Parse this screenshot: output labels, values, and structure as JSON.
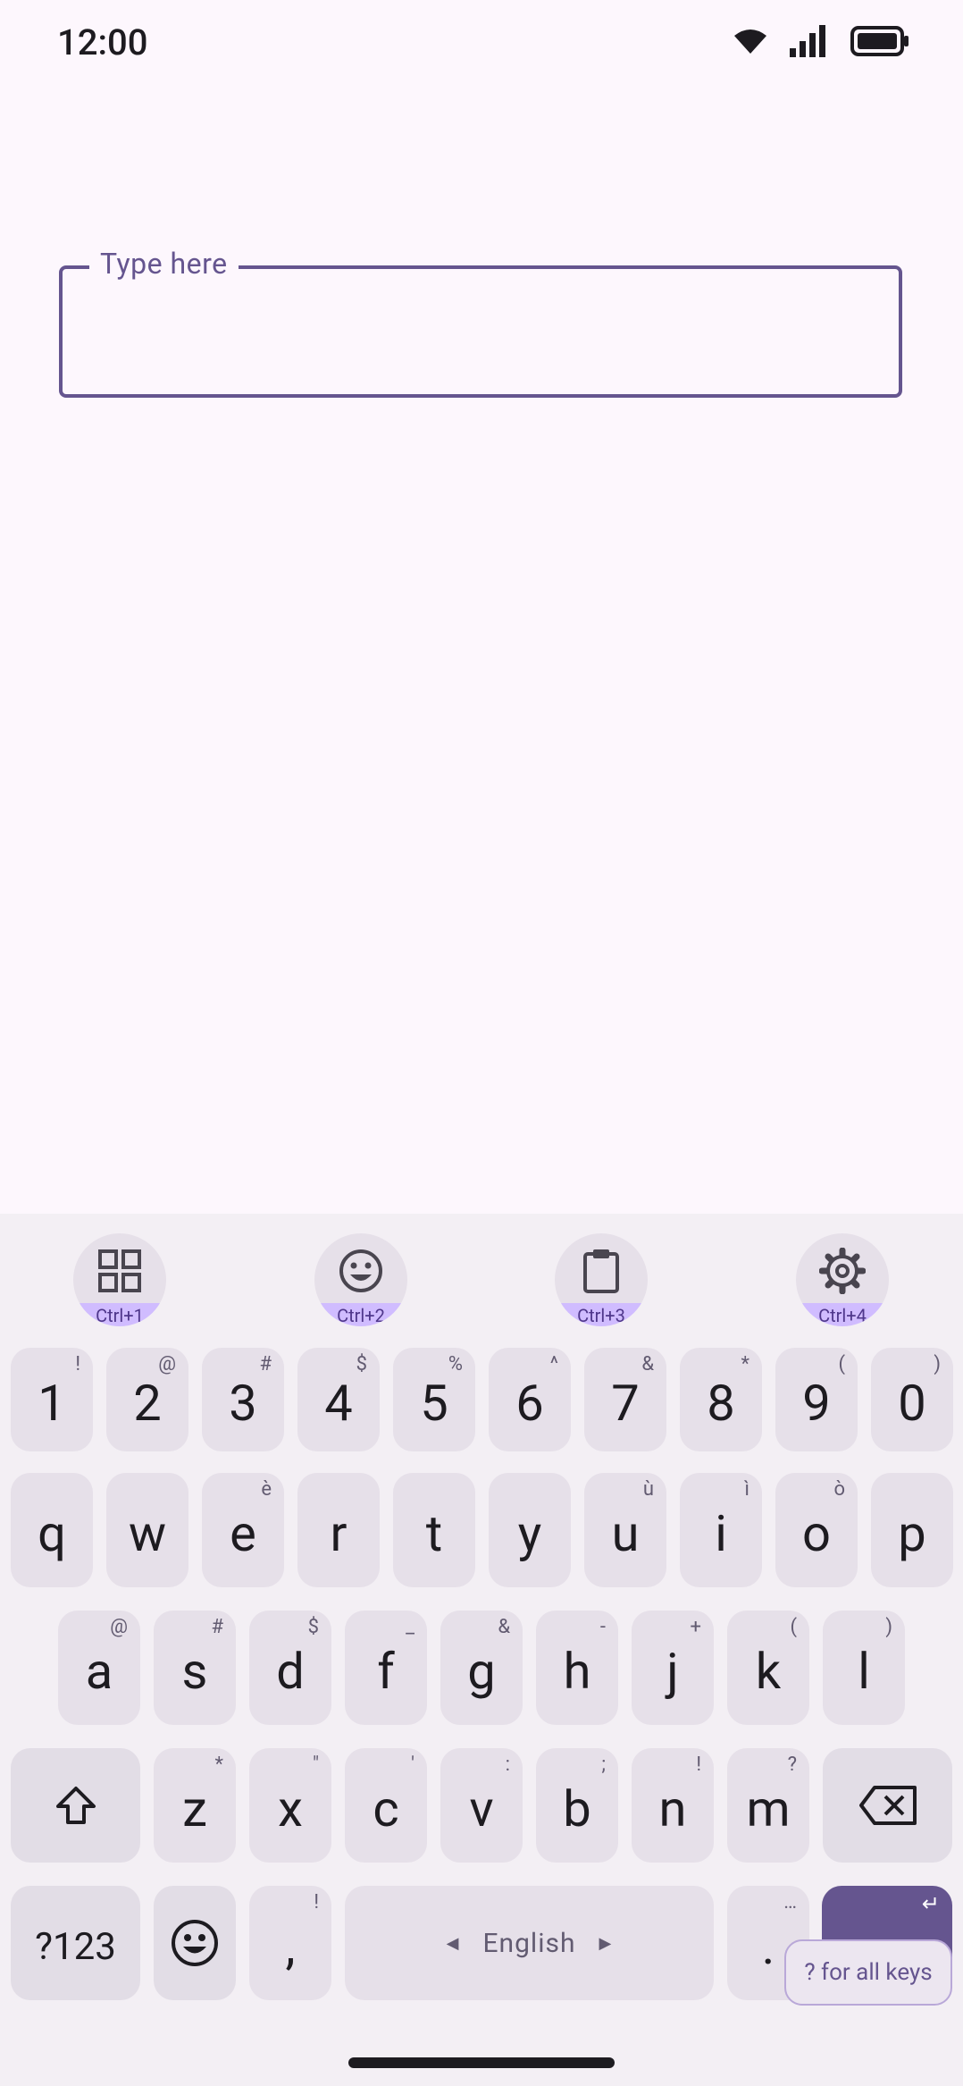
{
  "status_bar": {
    "time": "12:00",
    "icons": [
      "wifi-icon",
      "signal-icon",
      "battery-icon"
    ]
  },
  "text_field": {
    "label": "Type here",
    "value": ""
  },
  "toolbar": [
    {
      "name": "apps-grid-icon",
      "hint": "Ctrl+1"
    },
    {
      "name": "emoji-icon",
      "hint": "Ctrl+2"
    },
    {
      "name": "clipboard-icon",
      "hint": "Ctrl+3"
    },
    {
      "name": "settings-icon",
      "hint": "Ctrl+4"
    }
  ],
  "rows": {
    "numbers": [
      {
        "key": "1",
        "hint": "!"
      },
      {
        "key": "2",
        "hint": "@"
      },
      {
        "key": "3",
        "hint": "#"
      },
      {
        "key": "4",
        "hint": "$"
      },
      {
        "key": "5",
        "hint": "%"
      },
      {
        "key": "6",
        "hint": "^"
      },
      {
        "key": "7",
        "hint": "&"
      },
      {
        "key": "8",
        "hint": "*"
      },
      {
        "key": "9",
        "hint": "("
      },
      {
        "key": "0",
        "hint": ")"
      }
    ],
    "top": [
      {
        "key": "q",
        "hint": ""
      },
      {
        "key": "w",
        "hint": ""
      },
      {
        "key": "e",
        "hint": "è"
      },
      {
        "key": "r",
        "hint": ""
      },
      {
        "key": "t",
        "hint": ""
      },
      {
        "key": "y",
        "hint": ""
      },
      {
        "key": "u",
        "hint": "ù"
      },
      {
        "key": "i",
        "hint": "ì"
      },
      {
        "key": "o",
        "hint": "ò"
      },
      {
        "key": "p",
        "hint": ""
      }
    ],
    "middle": [
      {
        "key": "a",
        "hint": "@"
      },
      {
        "key": "s",
        "hint": "#"
      },
      {
        "key": "d",
        "hint": "$"
      },
      {
        "key": "f",
        "hint": "_"
      },
      {
        "key": "g",
        "hint": "&"
      },
      {
        "key": "h",
        "hint": "-"
      },
      {
        "key": "j",
        "hint": "+"
      },
      {
        "key": "k",
        "hint": "("
      },
      {
        "key": "l",
        "hint": ")"
      }
    ],
    "bottom": [
      {
        "key": "z",
        "hint": "*"
      },
      {
        "key": "x",
        "hint": "\""
      },
      {
        "key": "c",
        "hint": "'"
      },
      {
        "key": "v",
        "hint": ":"
      },
      {
        "key": "b",
        "hint": ";"
      },
      {
        "key": "n",
        "hint": "!"
      },
      {
        "key": "m",
        "hint": "?"
      }
    ]
  },
  "bottom_row": {
    "symbols_label": "?123",
    "comma": ",",
    "comma_hint": "!",
    "space_label": "English",
    "period": ".",
    "period_hint": "…",
    "enter_hint": "↵"
  },
  "all_keys_hint": "? for all keys",
  "colors": {
    "accent": "#65558f",
    "key": "#e6e0e9",
    "keyboard_bg": "#f3eff4",
    "page_bg": "#fdf7fd"
  }
}
